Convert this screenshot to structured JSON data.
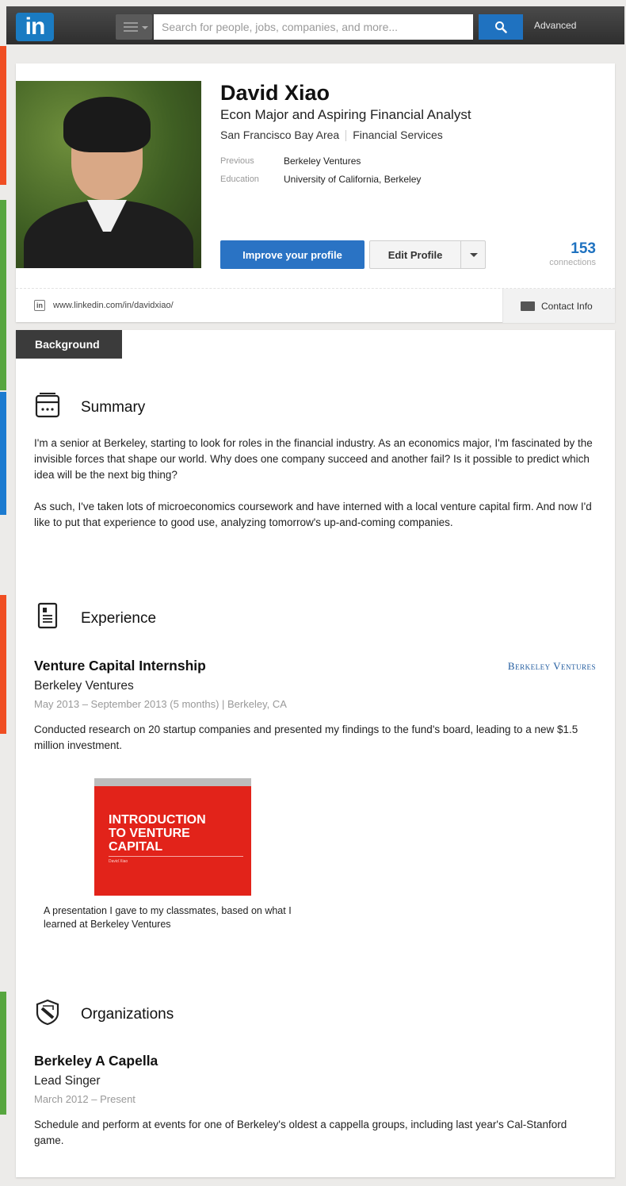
{
  "colors": {
    "accent": "#1f72c0",
    "tab": "#3b3b3b",
    "edge_orange": "#f04e23",
    "edge_green": "#57a63f",
    "edge_blue": "#1c7bd0"
  },
  "topbar": {
    "logo_text": "in",
    "search_placeholder": "Search for people, jobs, companies, and more...",
    "advanced_label": "Advanced"
  },
  "profile": {
    "name": "David Xiao",
    "headline": "Econ Major and Aspiring Financial Analyst",
    "location": "San Francisco Bay Area",
    "industry": "Financial Services",
    "previous_label": "Previous",
    "previous_value": "Berkeley Ventures",
    "education_label": "Education",
    "education_value": "University of California, Berkeley",
    "improve_button": "Improve your profile",
    "edit_button": "Edit Profile",
    "connections_count": "153",
    "connections_label": "connections",
    "url": "www.linkedin.com/in/davidxiao/",
    "contact_label": "Contact Info"
  },
  "background": {
    "tab_label": "Background",
    "summary": {
      "title": "Summary",
      "p1": "I'm a senior at Berkeley, starting to look for roles in the financial industry. As an economics major, I'm fascinated by the invisible forces that shape our world. Why does one company succeed and another fail? Is it possible to predict which idea will be the next big thing?",
      "p2": "As such, I've taken lots of microeconomics coursework and have interned with a local venture capital firm. And now I'd like to put that experience to good use, analyzing tomorrow's up-and-coming companies."
    },
    "experience": {
      "title": "Experience",
      "job_title": "Venture Capital Internship",
      "company": "Berkeley Ventures",
      "company_logo_text": "Berkeley Ventures",
      "dates": "May 2013 – September 2013 (5 months)  |  Berkeley, CA",
      "description": "Conducted research on 20 startup companies and presented my findings to the fund's board, leading to a new $1.5 million investment.",
      "media_title_1": "INTRODUCTION",
      "media_title_2": "TO VENTURE",
      "media_title_3": "CAPITAL",
      "media_author": "David Xiao",
      "media_caption": "A presentation I gave to my classmates, based on what I learned at Berkeley Ventures"
    },
    "organizations": {
      "title": "Organizations",
      "org_name": "Berkeley A Capella",
      "role": "Lead Singer",
      "dates": "March 2012 – Present",
      "description": "Schedule and perform at events for one of Berkeley's oldest a cappella groups, including last year's Cal-Stanford game."
    }
  }
}
